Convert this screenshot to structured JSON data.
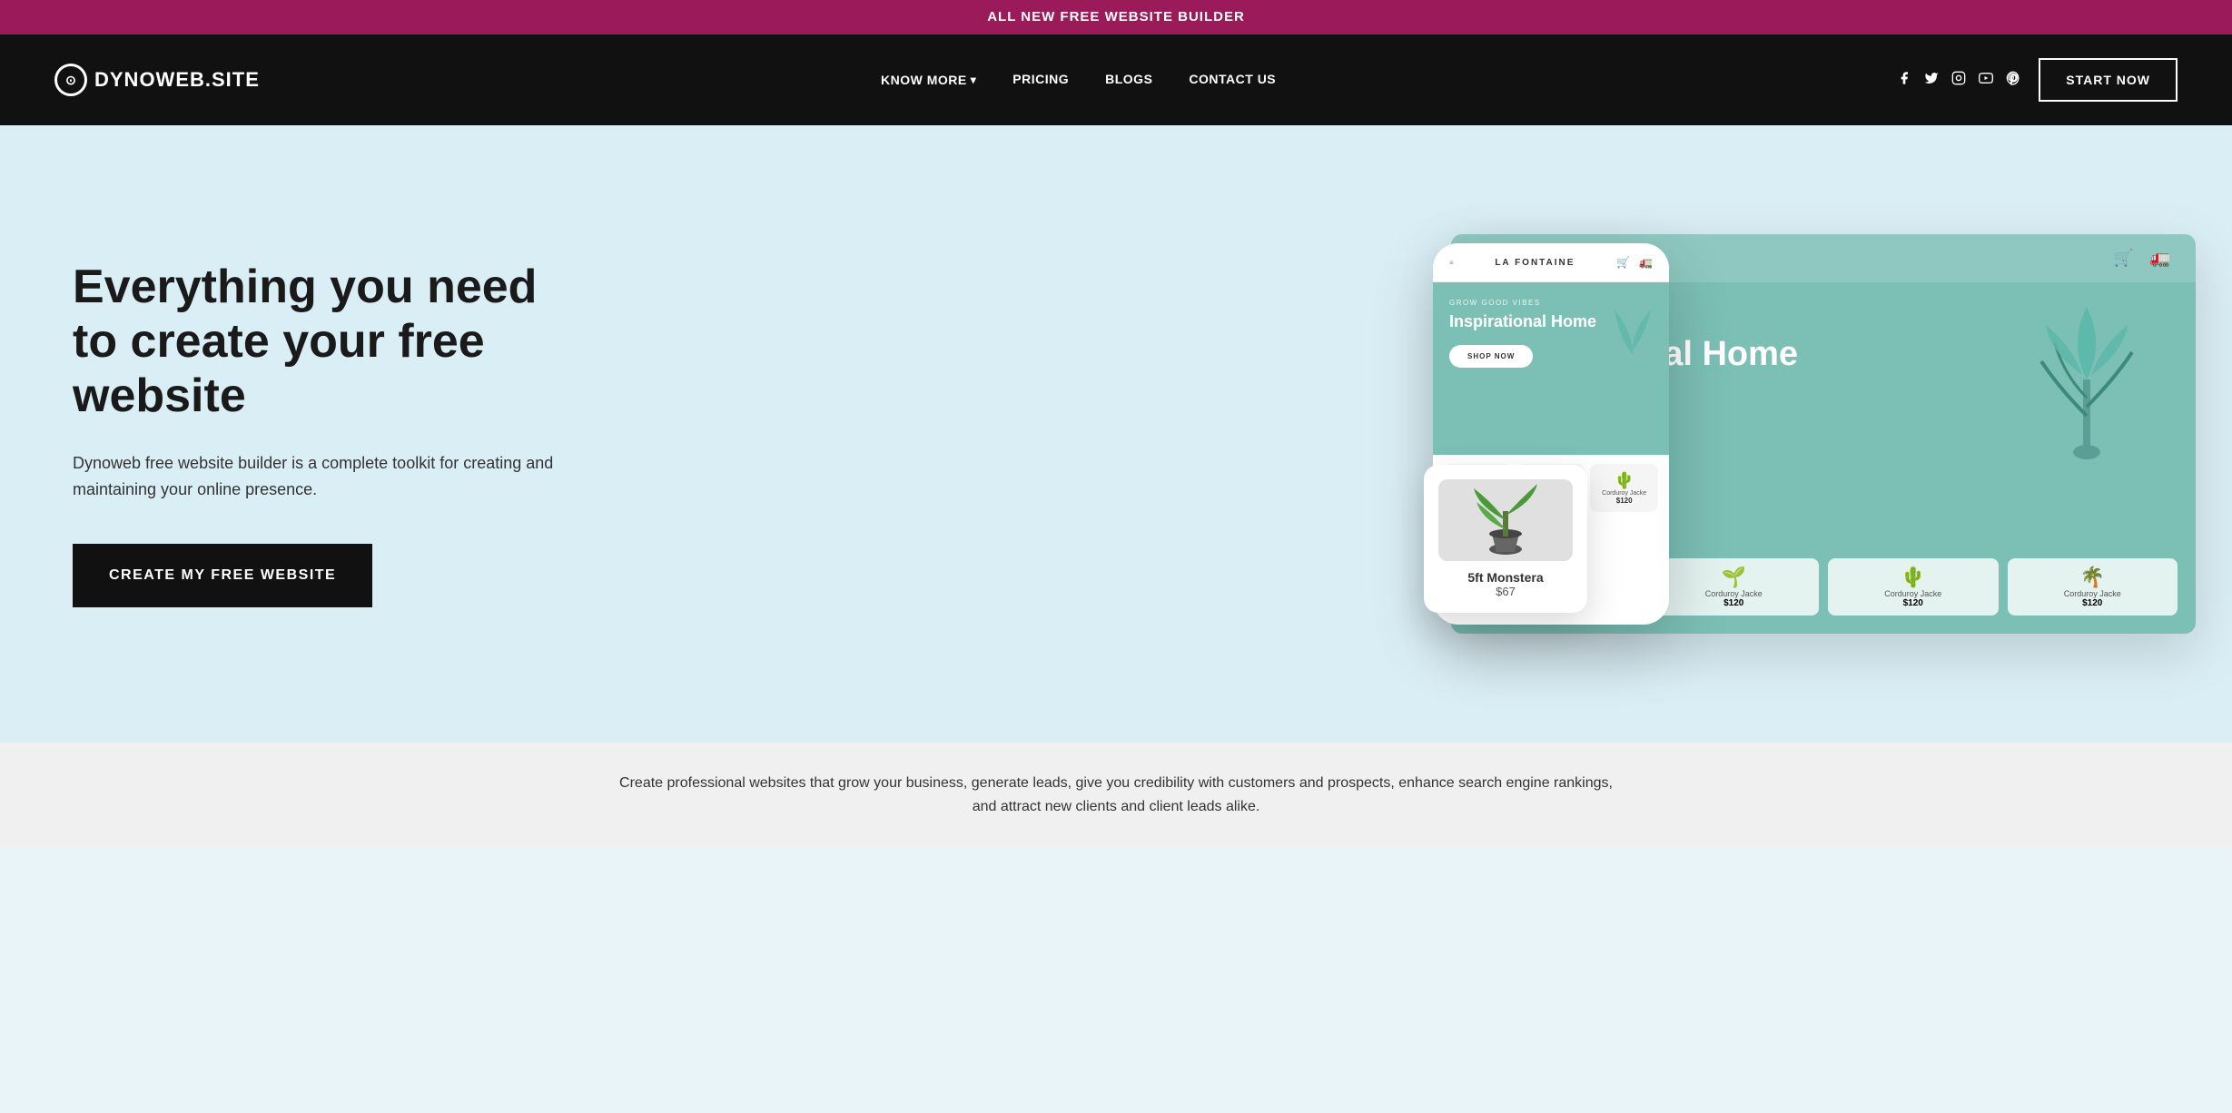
{
  "banner": {
    "text": "ALL NEW FREE WEBSITE BUILDER"
  },
  "navbar": {
    "logo_text": "DYNOWEB.SITE",
    "logo_icon": "⊙",
    "nav_items": [
      {
        "label": "KNOW MORE",
        "dropdown": true
      },
      {
        "label": "PRICING",
        "dropdown": false
      },
      {
        "label": "BLOGS",
        "dropdown": false
      },
      {
        "label": "CONTACT US",
        "dropdown": false
      }
    ],
    "social_icons": [
      {
        "name": "facebook-icon",
        "symbol": "f"
      },
      {
        "name": "twitter-icon",
        "symbol": "t"
      },
      {
        "name": "instagram-icon",
        "symbol": "in"
      },
      {
        "name": "youtube-icon",
        "symbol": "▶"
      },
      {
        "name": "pinterest-icon",
        "symbol": "p"
      }
    ],
    "start_now_label": "START NOW"
  },
  "hero": {
    "title": "Everything you need to create your free website",
    "description": "Dynoweb free website builder is a complete toolkit for creating and maintaining your online presence.",
    "cta_label": "CREATE MY FREE WEBSITE",
    "mockup": {
      "brand": "LA FONTAINE",
      "subtitle": "GROW GOOD VIBES",
      "title": "Inspirational Home",
      "shop_btn": "SHOP NOW",
      "mobile_subtitle": "GROW GOOD VIBES",
      "mobile_title": "Inspirational Home",
      "mobile_shop_btn": "SHOP NOW",
      "floating_product_name": "5ft Monstera",
      "floating_product_price": "$67",
      "products": [
        {
          "name": "Corduroy Jacke",
          "price": "$120"
        },
        {
          "name": "Corduroy Jacke",
          "price": "$120"
        },
        {
          "name": "Corduroy Jacke",
          "price": "$120"
        }
      ]
    }
  },
  "bottom_bar": {
    "text": "Create professional websites that grow your business, generate leads, give you credibility with customers and prospects, enhance search engine rankings, and attract new clients and client leads alike."
  },
  "colors": {
    "banner_bg": "#9b1a5a",
    "navbar_bg": "#111111",
    "hero_bg": "#daeef5",
    "teal": "#7bbfb5",
    "white": "#ffffff",
    "black": "#111111"
  }
}
